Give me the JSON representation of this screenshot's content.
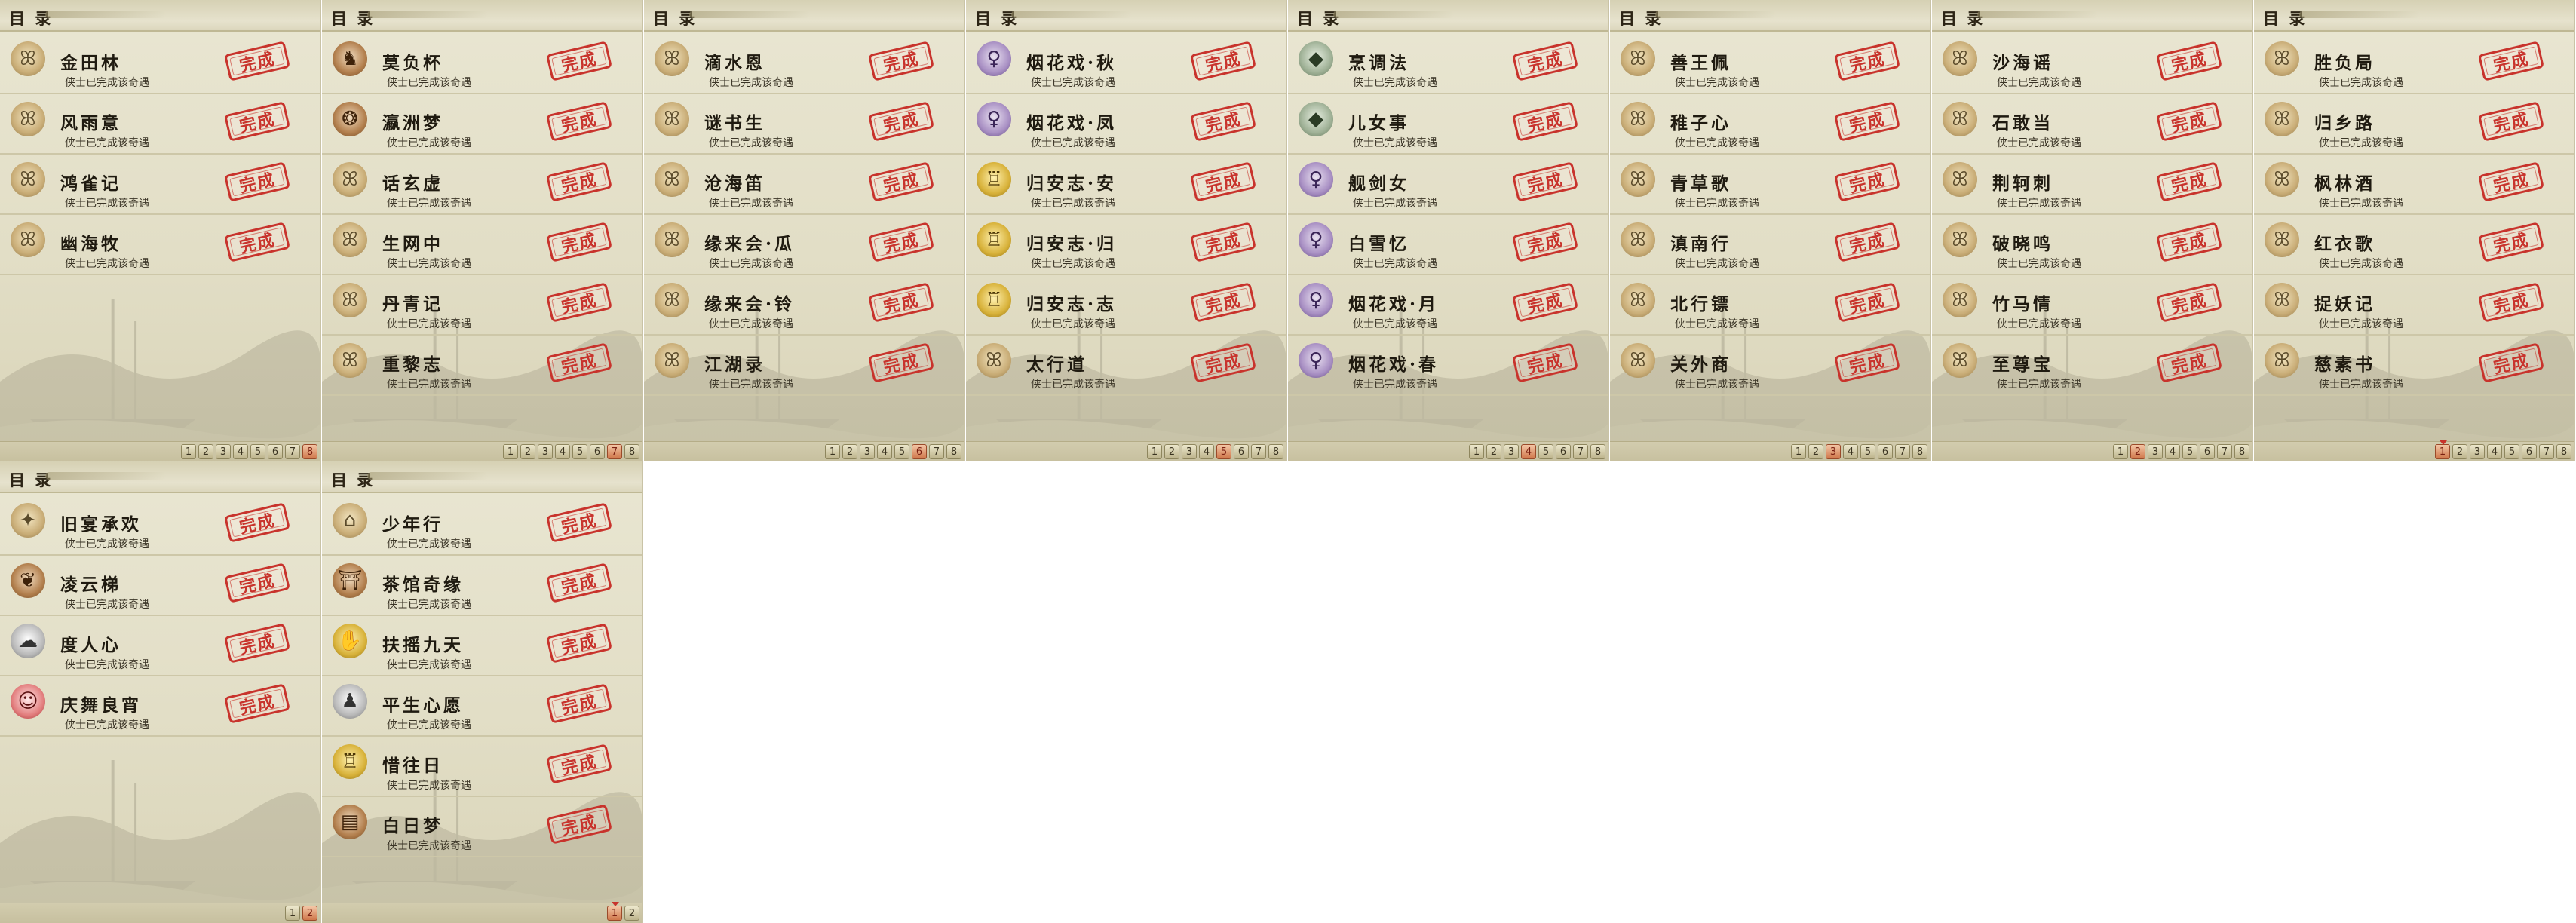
{
  "panels": [
    {
      "title": "目 录",
      "entries": [
        {
          "title": "金田林",
          "status": "侠士已完成该奇遇",
          "icon": "cat-icon",
          "stamp": "完成"
        },
        {
          "title": "风雨意",
          "status": "侠士已完成该奇遇",
          "icon": "cat-icon",
          "stamp": "完成"
        },
        {
          "title": "鸿雀记",
          "status": "侠士已完成该奇遇",
          "icon": "cat-icon",
          "stamp": "完成"
        },
        {
          "title": "幽海牧",
          "status": "侠士已完成该奇遇",
          "icon": "cat-icon",
          "stamp": "完成"
        }
      ],
      "pages": [
        "1",
        "2",
        "3",
        "4",
        "5",
        "6",
        "7",
        "8"
      ],
      "active_page": "8"
    },
    {
      "title": "目 录",
      "entries": [
        {
          "title": "莫负杯",
          "status": "侠士已完成该奇遇",
          "icon": "horse-icon",
          "stamp": "完成"
        },
        {
          "title": "瀛洲梦",
          "status": "侠士已完成该奇遇",
          "icon": "turtle-icon",
          "stamp": "完成"
        },
        {
          "title": "话玄虚",
          "status": "侠士已完成该奇遇",
          "icon": "cat-icon",
          "stamp": "完成"
        },
        {
          "title": "生网中",
          "status": "侠士已完成该奇遇",
          "icon": "cat-icon",
          "stamp": "完成"
        },
        {
          "title": "丹青记",
          "status": "侠士已完成该奇遇",
          "icon": "cat-icon",
          "stamp": "完成"
        },
        {
          "title": "重黎志",
          "status": "侠士已完成该奇遇",
          "icon": "cat-icon",
          "stamp": "完成"
        }
      ],
      "pages": [
        "1",
        "2",
        "3",
        "4",
        "5",
        "6",
        "7",
        "8"
      ],
      "active_page": "7"
    },
    {
      "title": "目 录",
      "entries": [
        {
          "title": "滴水恩",
          "status": "侠士已完成该奇遇",
          "icon": "cat-icon",
          "stamp": "完成"
        },
        {
          "title": "谜书生",
          "status": "侠士已完成该奇遇",
          "icon": "cat-icon",
          "stamp": "完成"
        },
        {
          "title": "沧海笛",
          "status": "侠士已完成该奇遇",
          "icon": "cat-icon",
          "stamp": "完成"
        },
        {
          "title": "缘来会·瓜",
          "status": "侠士已完成该奇遇",
          "icon": "cat-icon",
          "stamp": "完成"
        },
        {
          "title": "缘来会·铃",
          "status": "侠士已完成该奇遇",
          "icon": "cat-icon",
          "stamp": "完成"
        },
        {
          "title": "江湖录",
          "status": "侠士已完成该奇遇",
          "icon": "cat-icon",
          "stamp": "完成"
        }
      ],
      "pages": [
        "1",
        "2",
        "3",
        "4",
        "5",
        "6",
        "7",
        "8"
      ],
      "active_page": "6"
    },
    {
      "title": "目 录",
      "entries": [
        {
          "title": "烟花戏·秋",
          "status": "侠士已完成该奇遇",
          "icon": "fairy-icon",
          "stamp": "完成"
        },
        {
          "title": "烟花戏·凤",
          "status": "侠士已完成该奇遇",
          "icon": "fairy-icon",
          "stamp": "完成"
        },
        {
          "title": "归安志·安",
          "status": "侠士已完成该奇遇",
          "icon": "bell-icon",
          "stamp": "完成"
        },
        {
          "title": "归安志·归",
          "status": "侠士已完成该奇遇",
          "icon": "bell-icon",
          "stamp": "完成"
        },
        {
          "title": "归安志·志",
          "status": "侠士已完成该奇遇",
          "icon": "bell-icon",
          "stamp": "完成"
        },
        {
          "title": "太行道",
          "status": "侠士已完成该奇遇",
          "icon": "cat-icon",
          "stamp": "完成"
        }
      ],
      "pages": [
        "1",
        "2",
        "3",
        "4",
        "5",
        "6",
        "7",
        "8"
      ],
      "active_page": "5"
    },
    {
      "title": "目 录",
      "entries": [
        {
          "title": "烹调法",
          "status": "侠士已完成该奇遇",
          "icon": "stone-icon",
          "stamp": "完成"
        },
        {
          "title": "儿女事",
          "status": "侠士已完成该奇遇",
          "icon": "stone-icon",
          "stamp": "完成"
        },
        {
          "title": "舰剑女",
          "status": "侠士已完成该奇遇",
          "icon": "fairy-icon",
          "stamp": "完成"
        },
        {
          "title": "白雪忆",
          "status": "侠士已完成该奇遇",
          "icon": "fairy-icon",
          "stamp": "完成"
        },
        {
          "title": "烟花戏·月",
          "status": "侠士已完成该奇遇",
          "icon": "fairy-icon",
          "stamp": "完成"
        },
        {
          "title": "烟花戏·春",
          "status": "侠士已完成该奇遇",
          "icon": "fairy-icon",
          "stamp": "完成"
        }
      ],
      "pages": [
        "1",
        "2",
        "3",
        "4",
        "5",
        "6",
        "7",
        "8"
      ],
      "active_page": "4"
    },
    {
      "title": "目 录",
      "entries": [
        {
          "title": "善王佩",
          "status": "侠士已完成该奇遇",
          "icon": "cat-icon",
          "stamp": "完成"
        },
        {
          "title": "稚子心",
          "status": "侠士已完成该奇遇",
          "icon": "cat-icon",
          "stamp": "完成"
        },
        {
          "title": "青草歌",
          "status": "侠士已完成该奇遇",
          "icon": "cat-icon",
          "stamp": "完成"
        },
        {
          "title": "滇南行",
          "status": "侠士已完成该奇遇",
          "icon": "cat-icon",
          "stamp": "完成"
        },
        {
          "title": "北行镖",
          "status": "侠士已完成该奇遇",
          "icon": "cat-icon",
          "stamp": "完成"
        },
        {
          "title": "关外商",
          "status": "侠士已完成该奇遇",
          "icon": "cat-icon",
          "stamp": "完成"
        }
      ],
      "pages": [
        "1",
        "2",
        "3",
        "4",
        "5",
        "6",
        "7",
        "8"
      ],
      "active_page": "3"
    },
    {
      "title": "目 录",
      "entries": [
        {
          "title": "沙海谣",
          "status": "侠士已完成该奇遇",
          "icon": "cat-icon",
          "stamp": "完成"
        },
        {
          "title": "石敢当",
          "status": "侠士已完成该奇遇",
          "icon": "cat-icon",
          "stamp": "完成"
        },
        {
          "title": "荆轲刺",
          "status": "侠士已完成该奇遇",
          "icon": "cat-icon",
          "stamp": "完成"
        },
        {
          "title": "破晓鸣",
          "status": "侠士已完成该奇遇",
          "icon": "cat-icon",
          "stamp": "完成"
        },
        {
          "title": "竹马情",
          "status": "侠士已完成该奇遇",
          "icon": "cat-icon",
          "stamp": "完成"
        },
        {
          "title": "至尊宝",
          "status": "侠士已完成该奇遇",
          "icon": "cat-icon",
          "stamp": "完成"
        }
      ],
      "pages": [
        "1",
        "2",
        "3",
        "4",
        "5",
        "6",
        "7",
        "8"
      ],
      "active_page": "2"
    },
    {
      "title": "目 录",
      "entries": [
        {
          "title": "胜负局",
          "status": "侠士已完成该奇遇",
          "icon": "cat-icon",
          "stamp": "完成"
        },
        {
          "title": "归乡路",
          "status": "侠士已完成该奇遇",
          "icon": "cat-icon",
          "stamp": "完成"
        },
        {
          "title": "枫林酒",
          "status": "侠士已完成该奇遇",
          "icon": "cat-icon",
          "stamp": "完成"
        },
        {
          "title": "红衣歌",
          "status": "侠士已完成该奇遇",
          "icon": "cat-icon",
          "stamp": "完成"
        },
        {
          "title": "捉妖记",
          "status": "侠士已完成该奇遇",
          "icon": "cat-icon",
          "stamp": "完成"
        },
        {
          "title": "慈素书",
          "status": "侠士已完成该奇遇",
          "icon": "cat-icon",
          "stamp": "完成"
        }
      ],
      "pages": [
        "1",
        "2",
        "3",
        "4",
        "5",
        "6",
        "7",
        "8"
      ],
      "active_page": "1"
    },
    {
      "title": "目 录",
      "entries": [
        {
          "title": "旧宴承欢",
          "status": "侠士已完成该奇遇",
          "icon": "crane-icon",
          "stamp": "完成"
        },
        {
          "title": "凌云梯",
          "status": "侠士已完成该奇遇",
          "icon": "fox-icon",
          "stamp": "完成"
        },
        {
          "title": "度人心",
          "status": "侠士已完成该奇遇",
          "icon": "ghost-icon",
          "stamp": "完成"
        },
        {
          "title": "庆舞良宵",
          "status": "侠士已完成该奇遇",
          "icon": "mask-icon",
          "stamp": "完成"
        }
      ],
      "pages": [
        "1",
        "2"
      ],
      "active_page": "2"
    },
    {
      "title": "目 录",
      "entries": [
        {
          "title": "少年行",
          "status": "侠士已完成该奇遇",
          "icon": "hat-icon",
          "stamp": "完成"
        },
        {
          "title": "茶馆奇缘",
          "status": "侠士已完成该奇遇",
          "icon": "teahouse-icon",
          "stamp": "完成"
        },
        {
          "title": "扶摇九天",
          "status": "侠士已完成该奇遇",
          "icon": "hand-icon",
          "stamp": "完成"
        },
        {
          "title": "平生心愿",
          "status": "侠士已完成该奇遇",
          "icon": "doll-icon",
          "stamp": "完成"
        },
        {
          "title": "惜往日",
          "status": "侠士已完成该奇遇",
          "icon": "bell-icon",
          "stamp": "完成"
        },
        {
          "title": "白日梦",
          "status": "侠士已完成该奇遇",
          "icon": "scroll-icon",
          "stamp": "完成"
        }
      ],
      "pages": [
        "1",
        "2"
      ],
      "active_page": "1"
    }
  ]
}
